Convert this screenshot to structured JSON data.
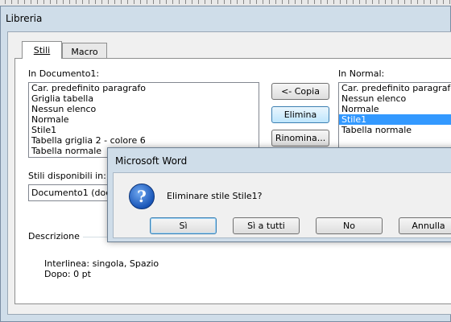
{
  "window": {
    "title": "Libreria"
  },
  "tabs": [
    {
      "label": "Stili",
      "active": true
    },
    {
      "label": "Macro",
      "active": false
    }
  ],
  "left_pane": {
    "label": "In Documento1:",
    "items": [
      "Car. predefinito paragrafo",
      "Griglia tabella",
      "Nessun elenco",
      "Normale",
      "Stile1",
      "Tabella griglia 2 - colore 6",
      "Tabella normale"
    ],
    "available_label": "Stili disponibili in:",
    "available_value": "Documento1 (docu"
  },
  "right_pane": {
    "label": "In Normal:",
    "items": [
      "Car. predefinito paragrafo",
      "Nessun elenco",
      "Normale",
      "Stile1",
      "Tabella normale"
    ],
    "selected_index": 3
  },
  "buttons": {
    "copy": "<- Copia",
    "delete": "Elimina",
    "rename": "Rinomina..."
  },
  "description": {
    "label": "Descrizione",
    "line1": "Interlinea: singola, Spazio",
    "line2": "Dopo:  0 pt"
  },
  "dialog": {
    "title": "Microsoft Word",
    "icon": "question-icon",
    "icon_glyph": "?",
    "message": "Eliminare stile Stile1?",
    "buttons": [
      "Sì",
      "Sì a tutti",
      "No",
      "Annulla"
    ]
  }
}
